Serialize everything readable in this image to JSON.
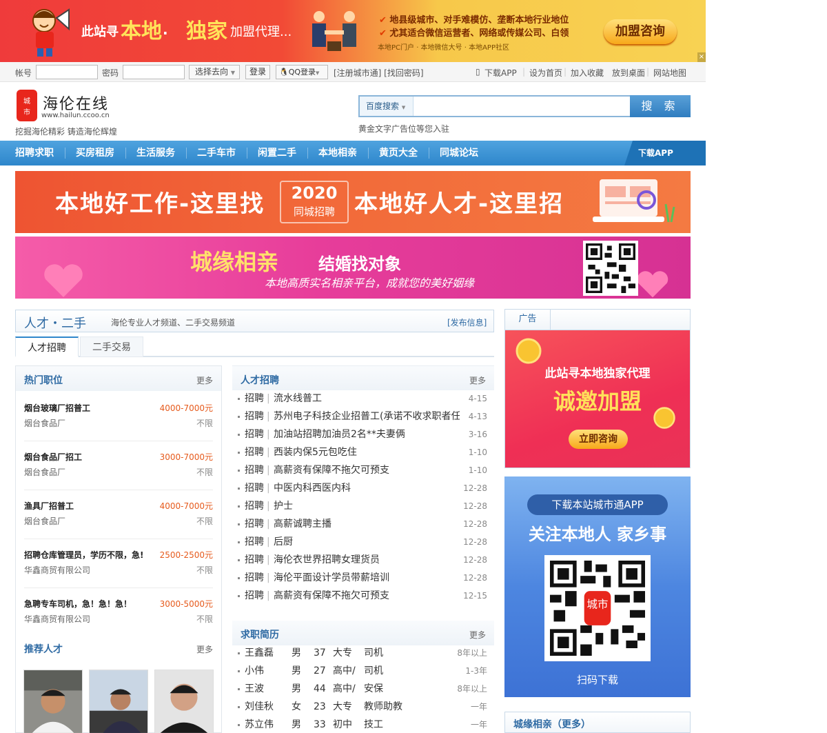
{
  "top_banner": {
    "headline_1": "此站寻",
    "headline_2": "本地",
    "headline_3": "·",
    "headline_4": "独家",
    "headline_5": "加盟代理...",
    "bullet_1": "地县级城市、对手难模仿、垄断本地行业地位",
    "bullet_2": "尤其适合微信运营者、网络或传媒公司、白领",
    "sub": "本地PC门户 · 本地微信大号 · 本地APP社区",
    "button": "加盟咨询",
    "close": "×"
  },
  "login_bar": {
    "account_label": "帐号",
    "password_label": "密码",
    "select_label": "选择去向",
    "login_button": "登录",
    "qq_login": "QQ登录",
    "register_links": "[注册城市通] [找回密码]",
    "right_links": [
      "下载APP",
      "设为首页",
      "加入收藏",
      "放到桌面",
      "网站地图"
    ]
  },
  "header": {
    "logo_text": "城市",
    "site_name": "海伦在线",
    "site_url": "www.hailun.ccoo.cn",
    "slogan": "挖掘海伦精彩 铸造海伦辉煌",
    "search_engine": "百度搜索",
    "search_button": "搜 索",
    "ad_text": "黄金文字广告位等您入驻"
  },
  "nav": {
    "items": [
      "招聘求职",
      "买房租房",
      "生活服务",
      "二手车市",
      "闲置二手",
      "本地相亲",
      "黄页大全",
      "同城论坛"
    ],
    "app": "下载APP"
  },
  "banner_1": {
    "left": "本地好工作-这里找",
    "year": "2020",
    "year_sub": "同城招聘",
    "right": "本地好人才-这里招"
  },
  "banner_2": {
    "title": "城缘相亲",
    "subtitle": "结婚找对象",
    "desc": "本地高质实名相亲平台，成就您的美好姻缘"
  },
  "section": {
    "title": "人才・二手",
    "desc": "海伦专业人才频道、二手交易频道",
    "publish": "[发布信息]",
    "tabs": [
      "人才招聘",
      "二手交易"
    ]
  },
  "hot_jobs": {
    "title": "热门职位",
    "more": "更多",
    "jobs": [
      {
        "name": "烟台玻璃厂招普工",
        "salary": "4000-7000元",
        "company": "烟台食品厂",
        "edu": "不限"
      },
      {
        "name": "烟台食品厂招工",
        "salary": "3000-7000元",
        "company": "烟台食品厂",
        "edu": "不限"
      },
      {
        "name": "渔具厂招普工",
        "salary": "4000-7000元",
        "company": "烟台食品厂",
        "edu": "不限"
      },
      {
        "name": "招聘仓库管理员，学历不限，急!",
        "salary": "2500-2500元",
        "company": "华鑫商贸有限公司",
        "edu": "不限"
      },
      {
        "name": "急聘专车司机，急！急！急！",
        "salary": "3000-5000元",
        "company": "华鑫商贸有限公司",
        "edu": "不限"
      }
    ],
    "recommend_title": "推荐人才",
    "recommend_more": "更多"
  },
  "job_list": {
    "title": "人才招聘",
    "more": "更多",
    "rows": [
      {
        "cat": "招聘",
        "title": "流水线普工",
        "date": "4-15"
      },
      {
        "cat": "招聘",
        "title": "苏州电子科技企业招普工(承诺不收求职者任",
        "date": "4-13"
      },
      {
        "cat": "招聘",
        "title": "加油站招聘加油员2名**夫妻俩",
        "date": "3-16"
      },
      {
        "cat": "招聘",
        "title": "西装内保5元包吃住",
        "date": "1-10"
      },
      {
        "cat": "招聘",
        "title": "高薪资有保障不拖欠可预支",
        "date": "1-10"
      },
      {
        "cat": "招聘",
        "title": "中医内科西医内科",
        "date": "12-28"
      },
      {
        "cat": "招聘",
        "title": "护士",
        "date": "12-28"
      },
      {
        "cat": "招聘",
        "title": "高薪诚聘主播",
        "date": "12-28"
      },
      {
        "cat": "招聘",
        "title": "后厨",
        "date": "12-28"
      },
      {
        "cat": "招聘",
        "title": "海伦衣世界招聘女理货员",
        "date": "12-28"
      },
      {
        "cat": "招聘",
        "title": "海伦平面设计学员带薪培训",
        "date": "12-28"
      },
      {
        "cat": "招聘",
        "title": "高薪资有保障不拖欠可预支",
        "date": "12-15"
      }
    ]
  },
  "resume": {
    "title": "求职简历",
    "more": "更多",
    "rows": [
      {
        "name": "王鑫磊",
        "sex": "男",
        "age": "37",
        "edu": "大专",
        "job": "司机",
        "exp": "8年以上"
      },
      {
        "name": "小伟",
        "sex": "男",
        "age": "27",
        "edu": "高中/",
        "job": "司机",
        "exp": "1-3年"
      },
      {
        "name": "王波",
        "sex": "男",
        "age": "44",
        "edu": "高中/",
        "job": "安保",
        "exp": "8年以上"
      },
      {
        "name": "刘佳秋",
        "sex": "女",
        "age": "23",
        "edu": "大专",
        "job": "教师助教",
        "exp": "一年"
      },
      {
        "name": "苏立伟",
        "sex": "男",
        "age": "33",
        "edu": "初中",
        "job": "技工",
        "exp": "一年"
      }
    ]
  },
  "ad_box": {
    "tab": "广告",
    "line_1": "此站寻本地独家代理",
    "line_2": "诚邀加盟",
    "button": "立即咨询"
  },
  "app_box": {
    "top": "下载本站城市通APP",
    "slogan": "关注本地人 家乡事",
    "qr_label": "城市",
    "bottom": "扫码下载"
  },
  "city_box": {
    "title": "城缘相亲（更多）"
  },
  "colors": {
    "nav_blue": "#2e86cb",
    "salary_orange": "#e65a1c",
    "title_blue": "#2e6aa3"
  }
}
